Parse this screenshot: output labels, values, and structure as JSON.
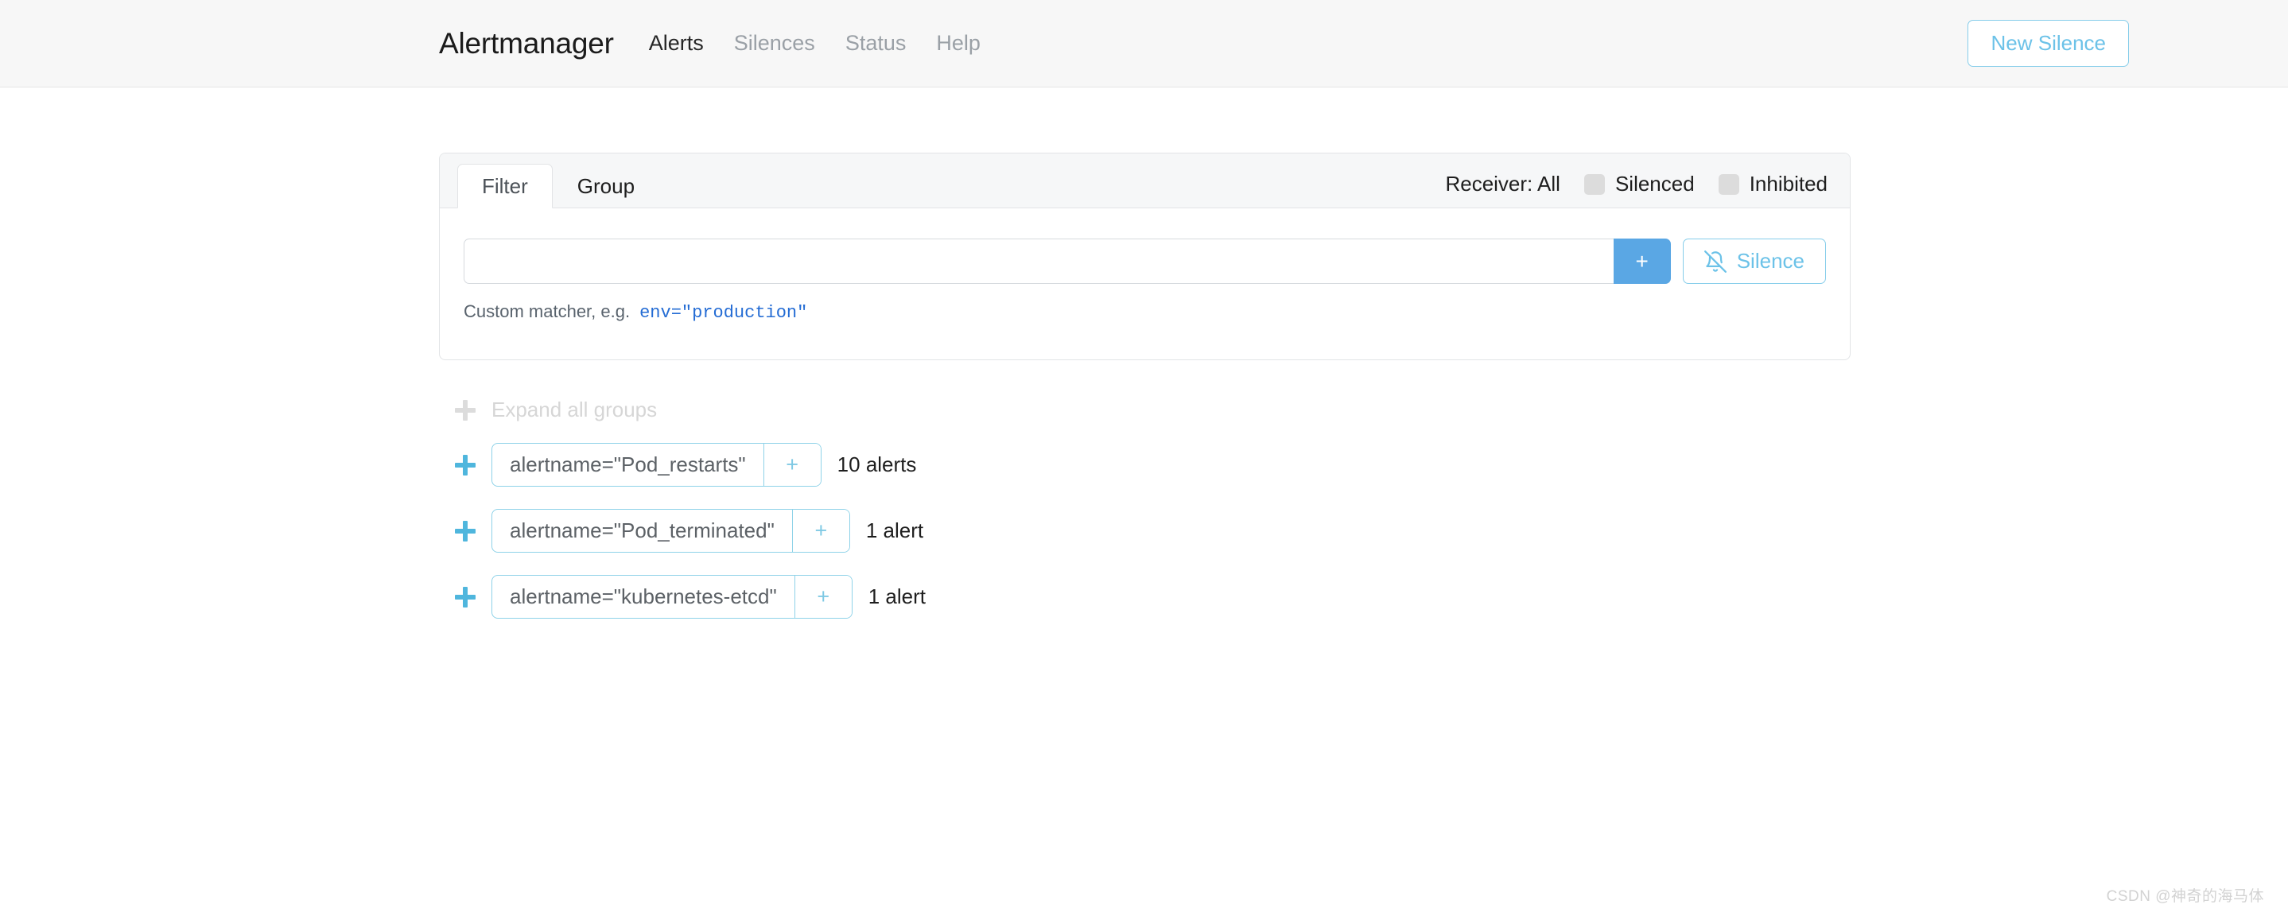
{
  "navbar": {
    "brand": "Alertmanager",
    "links": [
      {
        "label": "Alerts",
        "active": true
      },
      {
        "label": "Silences",
        "active": false
      },
      {
        "label": "Status",
        "active": false
      },
      {
        "label": "Help",
        "active": false
      }
    ],
    "new_silence_label": "New Silence"
  },
  "filter_card": {
    "tabs": [
      {
        "label": "Filter",
        "active": true
      },
      {
        "label": "Group",
        "active": false
      }
    ],
    "receiver_label": "Receiver: All",
    "toggles": [
      {
        "label": "Silenced",
        "checked": false
      },
      {
        "label": "Inhibited",
        "checked": false
      }
    ],
    "matcher_input_value": "",
    "matcher_input_placeholder": "",
    "add_button_label": "+",
    "silence_button_label": "Silence",
    "silence_button_icon": "bell-slash-icon",
    "hint_text": "Custom matcher, e.g.",
    "hint_example": "env=\"production\""
  },
  "expand_all": {
    "label": "Expand all groups",
    "icon": "plus-icon"
  },
  "groups": [
    {
      "matcher": "alertname=\"Pod_restarts\"",
      "add_label": "+",
      "count_label": "10 alerts"
    },
    {
      "matcher": "alertname=\"Pod_terminated\"",
      "add_label": "+",
      "count_label": "1 alert"
    },
    {
      "matcher": "alertname=\"kubernetes-etcd\"",
      "add_label": "+",
      "count_label": "1 alert"
    }
  ],
  "watermark": "CSDN @神奇的海马体",
  "colors": {
    "accent_blue": "#5aa7e4",
    "light_blue": "#6cc2e8",
    "pill_border": "#8ed2e8",
    "navbar_bg": "#f7f7f7",
    "card_header_bg": "#f6f7f8",
    "muted_text": "#9aa0a6"
  }
}
